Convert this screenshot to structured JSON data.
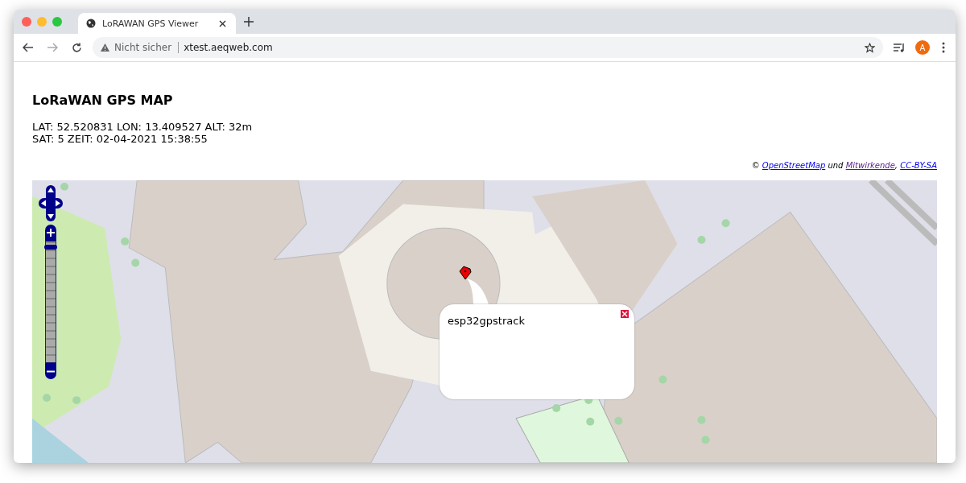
{
  "browser": {
    "tabs": [
      {
        "title": "LoRAWAN GPS Viewer",
        "selected": true
      }
    ],
    "address": {
      "security": "Nicht sicher",
      "url": "xtest.aeqweb.com"
    },
    "profile_initial": "A"
  },
  "page": {
    "title": "LoRaWAN GPS MAP",
    "readout": [
      "LAT: 52.520831 LON: 13.409527 ALT: 32m",
      "SAT: 5 ZEIT: 02-04-2021 15:38:55"
    ],
    "attribution": [
      {
        "kind": "plain",
        "text": "©"
      },
      {
        "kind": "link",
        "text": "OpenStreetMap",
        "visited": false
      },
      {
        "kind": "plain",
        "text": "und"
      },
      {
        "kind": "link",
        "text": "Mitwirkende",
        "visited": true
      },
      {
        "kind": "plain",
        "text": ","
      },
      {
        "kind": "link",
        "text": "CC-BY-SA",
        "visited": false
      }
    ]
  },
  "map": {
    "zoom_slider": {
      "level": 0.97
    },
    "popup": {
      "text": "esp32gpstrack"
    }
  }
}
